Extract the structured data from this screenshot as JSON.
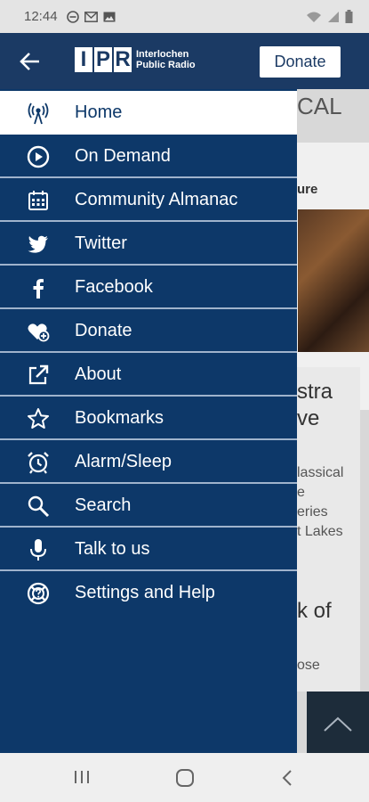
{
  "status": {
    "time": "12:44"
  },
  "header": {
    "logo_letters": [
      "I",
      "P",
      "R"
    ],
    "logo_line1": "Interlochen",
    "logo_line2": "Public Radio",
    "donate_label": "Donate"
  },
  "background": {
    "title_fragment": "CAL",
    "feature_label": "ure",
    "story1_line1": "stra",
    "story1_line2": "ve",
    "story1_desc1": "lassical",
    "story1_desc2": "e",
    "story1_desc3": "eries",
    "story1_desc4": "t Lakes",
    "story2_line1": "k of",
    "story2_desc1": "ose"
  },
  "menu": {
    "items": [
      {
        "label": "Home",
        "icon": "radio-tower-icon",
        "active": true
      },
      {
        "label": "On Demand",
        "icon": "play-circle-icon"
      },
      {
        "label": "Community Almanac",
        "icon": "calendar-icon"
      },
      {
        "label": "Twitter",
        "icon": "twitter-icon"
      },
      {
        "label": "Facebook",
        "icon": "facebook-icon"
      },
      {
        "label": "Donate",
        "icon": "heart-plus-icon"
      },
      {
        "label": "About",
        "icon": "external-link-icon"
      },
      {
        "label": "Bookmarks",
        "icon": "star-icon"
      },
      {
        "label": "Alarm/Sleep",
        "icon": "alarm-clock-icon"
      },
      {
        "label": "Search",
        "icon": "search-icon"
      },
      {
        "label": "Talk to us",
        "icon": "microphone-icon"
      },
      {
        "label": "Settings and Help",
        "icon": "help-lifebuoy-icon"
      }
    ]
  },
  "colors": {
    "drawer": "#0d3869",
    "app_bar": "#1b3a64",
    "divider": "#9fb3cc"
  }
}
